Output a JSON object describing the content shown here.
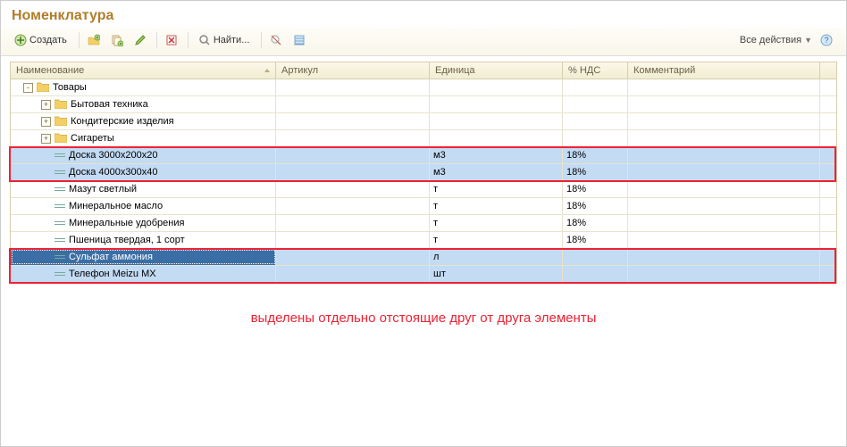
{
  "title": "Номенклатура",
  "toolbar": {
    "create": "Создать",
    "find": "Найти..."
  },
  "all_actions": "Все действия",
  "columns": {
    "name": "Наименование",
    "article": "Артикул",
    "unit": "Единица",
    "vat": "% НДС",
    "comment": "Комментарий"
  },
  "rows": [
    {
      "type": "folder",
      "level": 0,
      "exp": "-",
      "name": "Товары"
    },
    {
      "type": "folder",
      "level": 1,
      "exp": "+",
      "name": "Бытовая техника"
    },
    {
      "type": "folder",
      "level": 1,
      "exp": "+",
      "name": "Кондитерские изделия"
    },
    {
      "type": "folder",
      "level": 1,
      "exp": "+",
      "name": "Сигареты"
    },
    {
      "type": "item",
      "level": 1,
      "name": "Доска 3000х200х20",
      "unit": "м3",
      "vat": "18%",
      "sel": true
    },
    {
      "type": "item",
      "level": 1,
      "name": "Доска 4000х300х40",
      "unit": "м3",
      "vat": "18%",
      "sel": true
    },
    {
      "type": "item",
      "level": 1,
      "name": "Мазут светлый",
      "unit": "т",
      "vat": "18%"
    },
    {
      "type": "item",
      "level": 1,
      "name": "Минеральное масло",
      "unit": "т",
      "vat": "18%"
    },
    {
      "type": "item",
      "level": 1,
      "name": "Минеральные удобрения",
      "unit": "т",
      "vat": "18%"
    },
    {
      "type": "item",
      "level": 1,
      "name": "Пшеница твердая, 1 сорт",
      "unit": "т",
      "vat": "18%"
    },
    {
      "type": "item",
      "level": 1,
      "name": "Сульфат аммония",
      "unit": "л",
      "sel": true,
      "focus": true
    },
    {
      "type": "item",
      "level": 1,
      "name": "Телефон Meizu MX",
      "unit": "шт",
      "sel": true
    }
  ],
  "caption": "выделены отдельно отстоящие друг от друга элементы",
  "icons": {
    "create": "plus-circle-icon",
    "find": "magnifier-icon"
  }
}
